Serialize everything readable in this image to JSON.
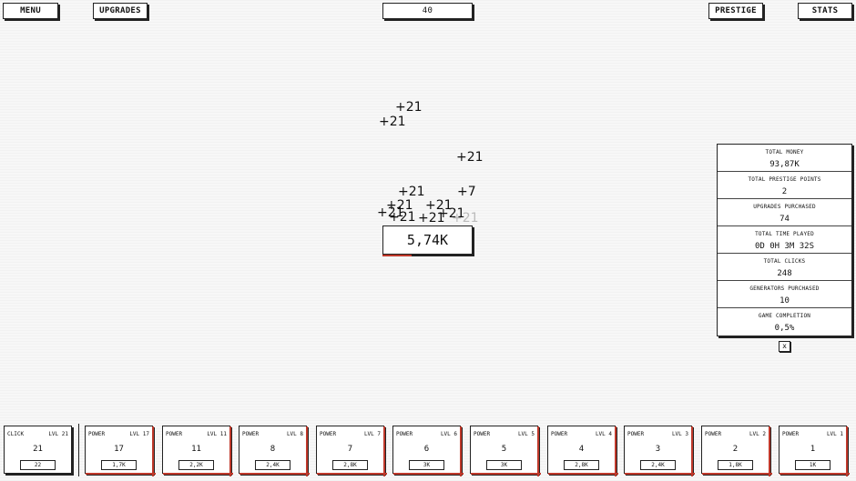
{
  "topbar": {
    "menu_label": "MENU",
    "upgrades_label": "UPGRADES",
    "counter_value": "40",
    "prestige_label": "PRESTIGE",
    "stats_label": "STATS"
  },
  "floating_texts": [
    {
      "text": "+21",
      "faded": true
    },
    {
      "text": "+21",
      "faded": false
    },
    {
      "text": "+21",
      "faded": false
    },
    {
      "text": "+21",
      "faded": false
    },
    {
      "text": "+7",
      "faded": false
    },
    {
      "text": "+21",
      "faded": false
    },
    {
      "text": "+21",
      "faded": false
    },
    {
      "text": "+21",
      "faded": false
    },
    {
      "text": "+21",
      "faded": false
    },
    {
      "text": "+21",
      "faded": false
    },
    {
      "text": "+21",
      "faded": false
    },
    {
      "text": "+21",
      "faded": true
    }
  ],
  "main": {
    "money_display": "5,74K",
    "money_progress_fraction": 0.32
  },
  "stats_panel": {
    "rows": [
      {
        "label": "TOTAL MONEY",
        "value": "93,87K"
      },
      {
        "label": "TOTAL PRESTIGE POINTS",
        "value": "2"
      },
      {
        "label": "UPGRADES PURCHASED",
        "value": "74"
      },
      {
        "label": "TOTAL TIME PLAYED",
        "value": "0D 0H 3M 32S"
      },
      {
        "label": "TOTAL CLICKS",
        "value": "248"
      },
      {
        "label": "GENERATORS PURCHASED",
        "value": "10"
      },
      {
        "label": "GAME COMPLETION",
        "value": "0,5%"
      }
    ],
    "close_label": "x"
  },
  "generators": [
    {
      "type": "CLICK",
      "level": "LVL 21",
      "count": "21",
      "cost": "22",
      "progress": 0.0
    },
    {
      "type": "POWER",
      "level": "LVL 17",
      "count": "17",
      "cost": "1,7K",
      "progress": 1.0
    },
    {
      "type": "POWER",
      "level": "LVL 11",
      "count": "11",
      "cost": "2,2K",
      "progress": 1.0
    },
    {
      "type": "POWER",
      "level": "LVL 8",
      "count": "8",
      "cost": "2,4K",
      "progress": 1.0
    },
    {
      "type": "POWER",
      "level": "LVL 7",
      "count": "7",
      "cost": "2,8K",
      "progress": 1.0
    },
    {
      "type": "POWER",
      "level": "LVL 6",
      "count": "6",
      "cost": "3K",
      "progress": 1.0
    },
    {
      "type": "POWER",
      "level": "LVL 5",
      "count": "5",
      "cost": "3K",
      "progress": 1.0
    },
    {
      "type": "POWER",
      "level": "LVL 4",
      "count": "4",
      "cost": "2,8K",
      "progress": 1.0
    },
    {
      "type": "POWER",
      "level": "LVL 3",
      "count": "3",
      "cost": "2,4K",
      "progress": 1.0
    },
    {
      "type": "POWER",
      "level": "LVL 2",
      "count": "2",
      "cost": "1,8K",
      "progress": 1.0
    },
    {
      "type": "POWER",
      "level": "LVL 1",
      "count": "1",
      "cost": "1K",
      "progress": 1.0
    }
  ],
  "colors": {
    "accent": "#c0392b",
    "border": "#222222",
    "background": "#f7f7f7"
  }
}
